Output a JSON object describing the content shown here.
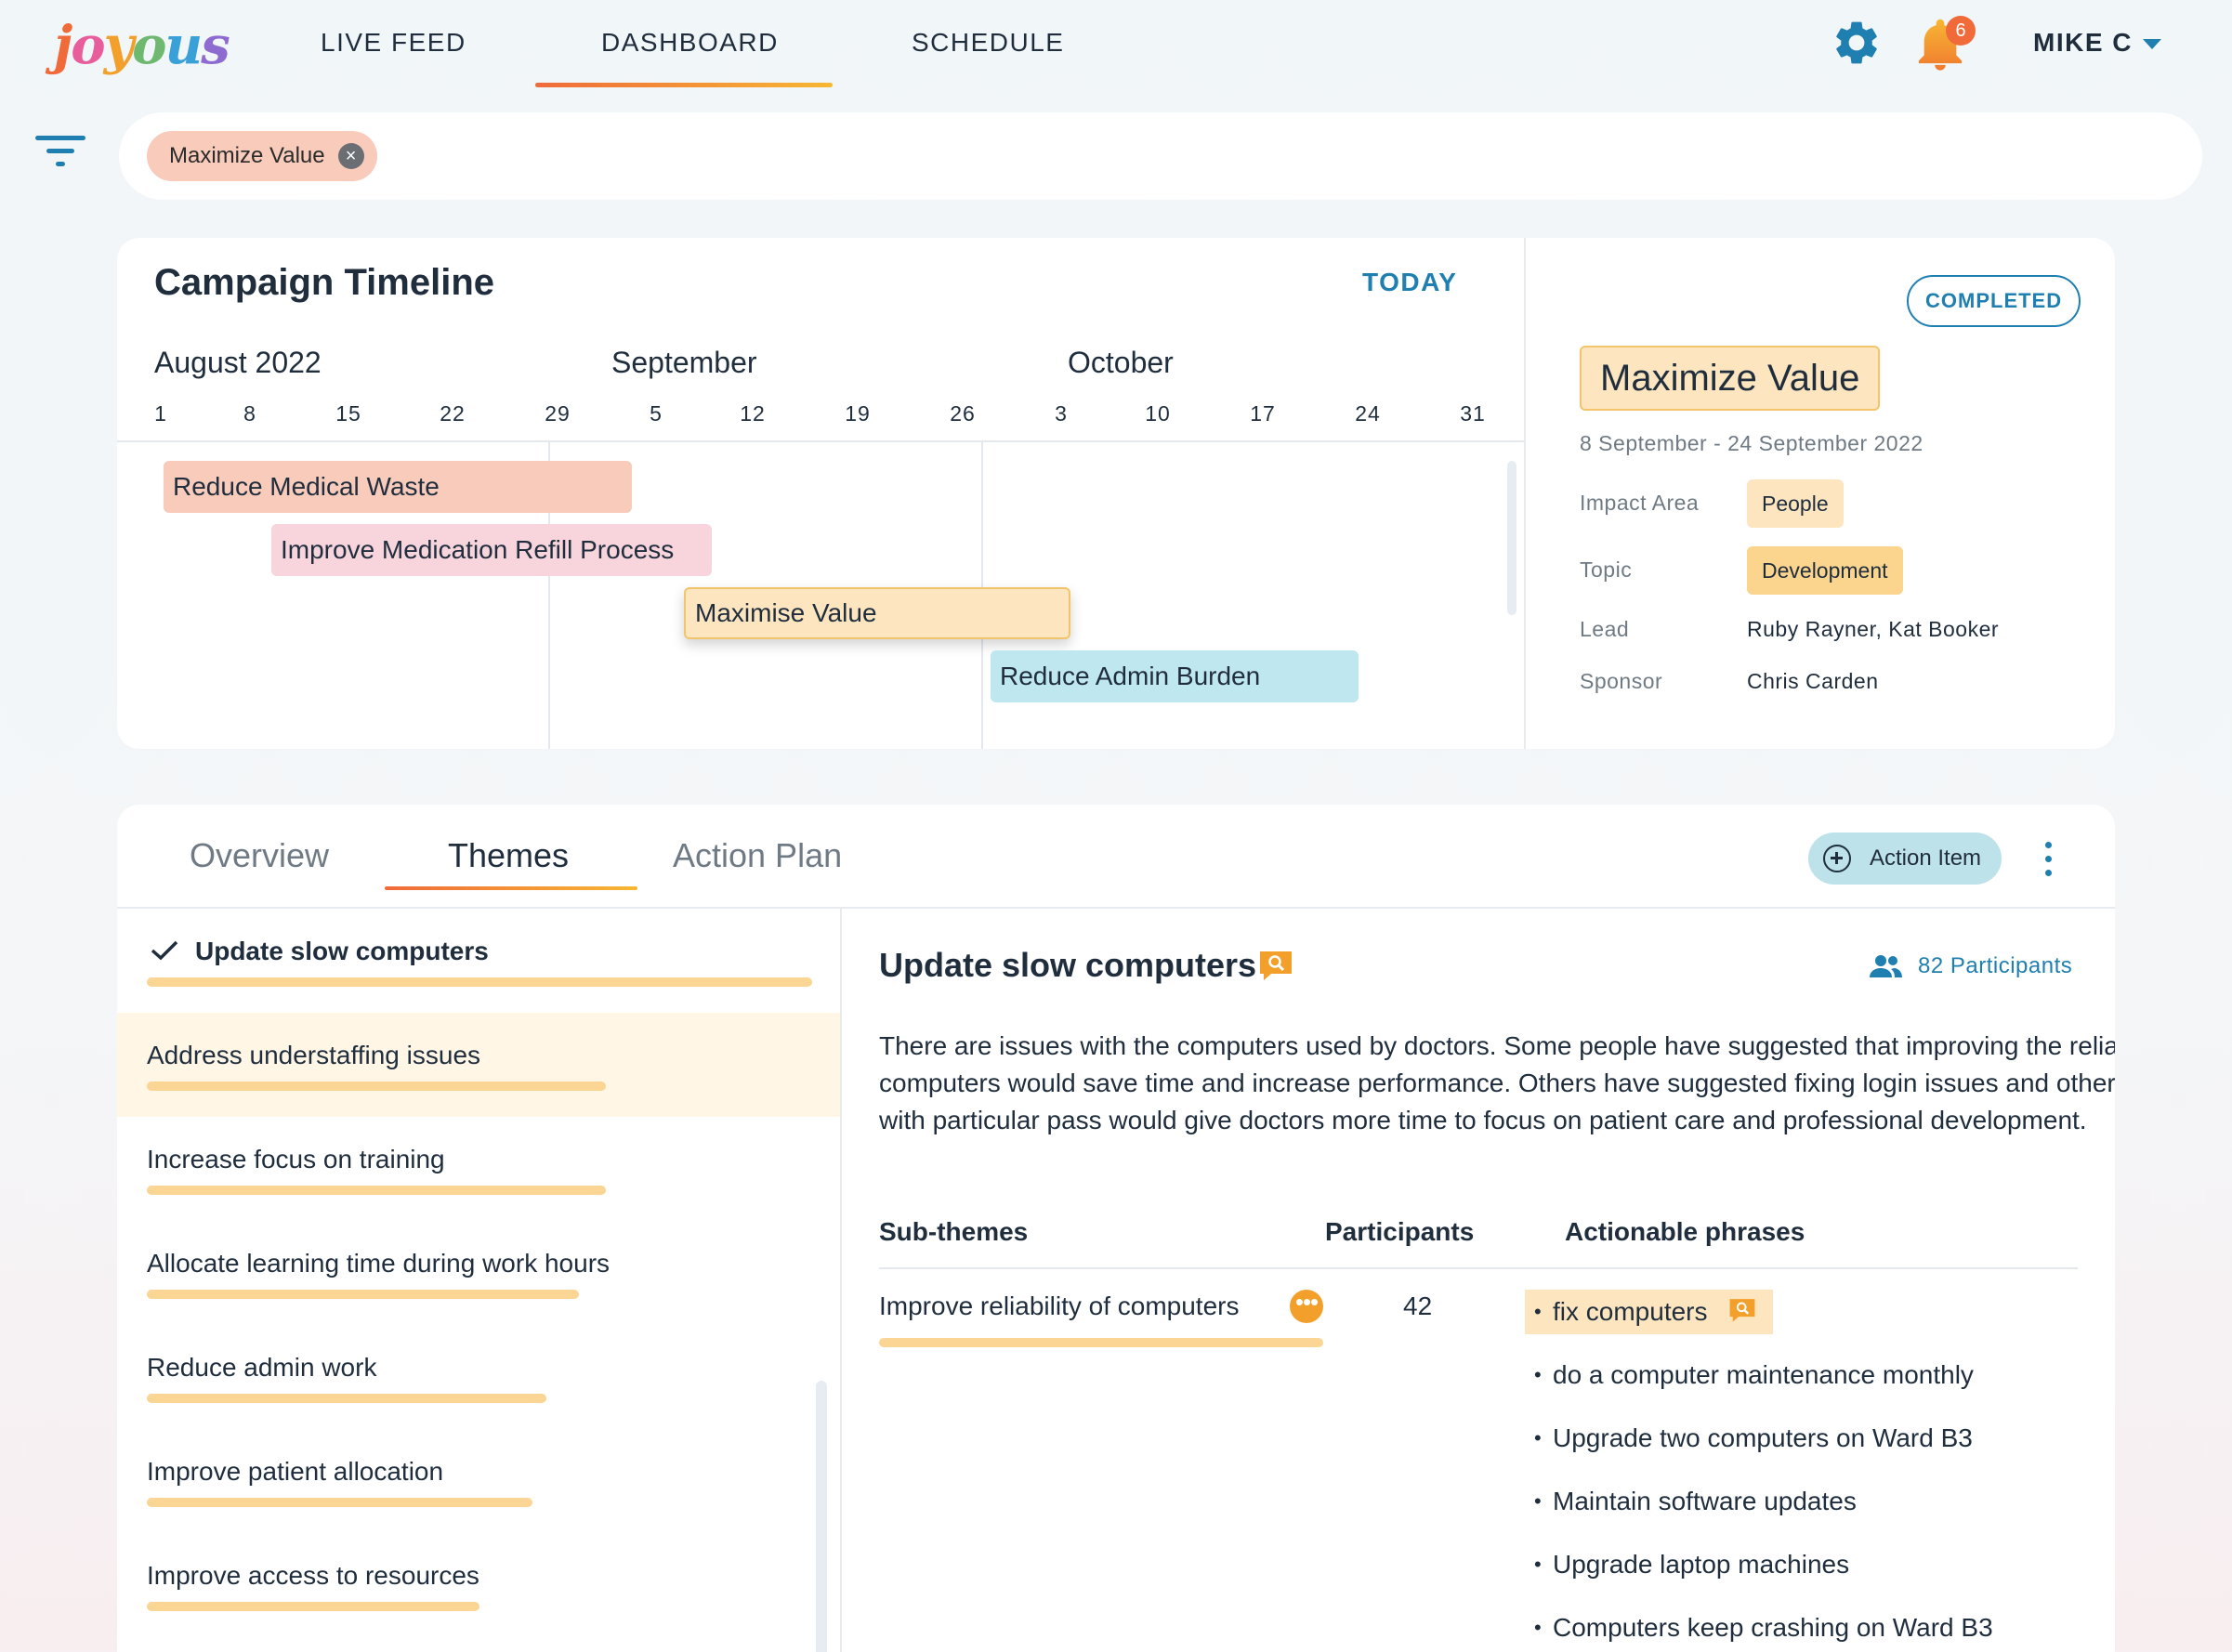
{
  "app": {
    "logo": "joyous",
    "logo_colors": [
      "#f06a3a",
      "#e85d9c",
      "#f2a02b",
      "#6fb86f",
      "#3aa0d8",
      "#8e6bd0"
    ],
    "nav": [
      "LIVE FEED",
      "DASHBOARD",
      "SCHEDULE"
    ],
    "active_nav": "DASHBOARD",
    "notifications": "6",
    "user": "MIKE C",
    "colors": {
      "accent": "#1e7fb0",
      "brand_orange": "#f06a3a",
      "highlight": "#fde6bf"
    }
  },
  "filters": {
    "chips": [
      "Maximize Value"
    ]
  },
  "timeline": {
    "title": "Campaign Timeline",
    "today_label": "TODAY",
    "months": [
      "August 2022",
      "September",
      "October"
    ],
    "days": [
      "1",
      "8",
      "15",
      "22",
      "29",
      "5",
      "12",
      "19",
      "26",
      "3",
      "10",
      "17",
      "24",
      "31"
    ],
    "campaigns": [
      {
        "name": "Reduce Medical Waste",
        "color": "#f9cbba"
      },
      {
        "name": "Improve Medication Refill Process",
        "color": "#f8d4dc"
      },
      {
        "name": "Maximise Value",
        "color": "#fde6bf",
        "selected": true
      },
      {
        "name": "Reduce Admin Burden",
        "color": "#bfe7ef"
      }
    ]
  },
  "campaign_detail": {
    "status": "COMPLETED",
    "title": "Maximize Value",
    "dates": "8 September - 24 September 2022",
    "impact_area_label": "Impact Area",
    "impact_area": "People",
    "topic_label": "Topic",
    "topic": "Development",
    "lead_label": "Lead",
    "lead": "Ruby Rayner, Kat Booker",
    "sponsor_label": "Sponsor",
    "sponsor": "Chris Carden"
  },
  "tabs": {
    "items": [
      "Overview",
      "Themes",
      "Action Plan"
    ],
    "active": "Themes",
    "action_button": "Action Item"
  },
  "themes": {
    "items": [
      {
        "label": "Update slow computers",
        "selected": true,
        "score": 1.0
      },
      {
        "label": "Address understaffing issues",
        "score": 0.69
      },
      {
        "label": "Increase focus on training",
        "score": 0.69
      },
      {
        "label": "Allocate learning time during work hours",
        "score": 0.65
      },
      {
        "label": "Reduce admin work",
        "score": 0.6
      },
      {
        "label": "Improve patient allocation",
        "score": 0.58
      },
      {
        "label": "Improve access to resources",
        "score": 0.5
      }
    ]
  },
  "theme_detail": {
    "title": "Update slow computers",
    "participants": "82 Participants",
    "description": "There are issues with the computers used by doctors. Some people have suggested that improving the reliability of computers would save time and increase performance. Others have suggested fixing login issues and other bugs with particular pass would give doctors more time to focus on patient care and professional development.",
    "columns": [
      "Sub-themes",
      "Participants",
      "Actionable phrases"
    ],
    "sub_theme": "Improve reliability of computers",
    "sub_theme_count": "42",
    "phrases": [
      "fix computers",
      "do a computer maintenance monthly",
      "Upgrade two computers on Ward B3",
      "Maintain software updates",
      "Upgrade laptop machines",
      "Computers keep crashing on Ward B3"
    ]
  }
}
